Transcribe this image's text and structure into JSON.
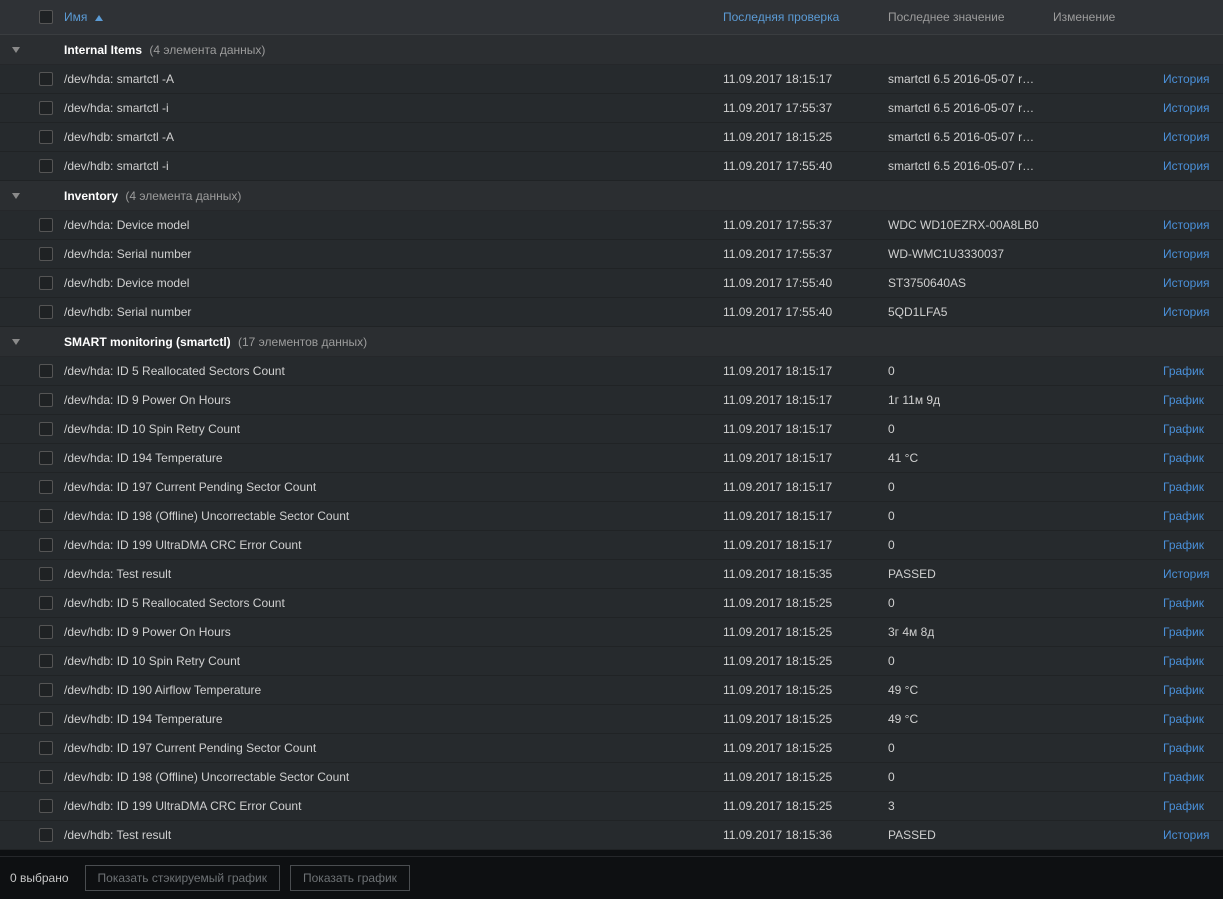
{
  "header": {
    "name": "Имя",
    "last_check": "Последняя проверка",
    "last_value": "Последнее значение",
    "change": "Изменение"
  },
  "action_labels": {
    "history": "История",
    "graph": "График"
  },
  "groups": [
    {
      "name": "Internal Items",
      "count_label": "(4 элемента данных)",
      "items": [
        {
          "name": "/dev/hda: smartctl -A",
          "time": "11.09.2017 18:15:17",
          "value": "smartctl 6.5 2016-05-07 r…",
          "action": "history"
        },
        {
          "name": "/dev/hda: smartctl -i",
          "time": "11.09.2017 17:55:37",
          "value": "smartctl 6.5 2016-05-07 r…",
          "action": "history"
        },
        {
          "name": "/dev/hdb: smartctl -A",
          "time": "11.09.2017 18:15:25",
          "value": "smartctl 6.5 2016-05-07 r…",
          "action": "history"
        },
        {
          "name": "/dev/hdb: smartctl -i",
          "time": "11.09.2017 17:55:40",
          "value": "smartctl 6.5 2016-05-07 r…",
          "action": "history"
        }
      ]
    },
    {
      "name": "Inventory",
      "count_label": "(4 элемента данных)",
      "items": [
        {
          "name": "/dev/hda: Device model",
          "time": "11.09.2017 17:55:37",
          "value": "WDC WD10EZRX-00A8LB0",
          "action": "history"
        },
        {
          "name": "/dev/hda: Serial number",
          "time": "11.09.2017 17:55:37",
          "value": "WD-WMC1U3330037",
          "action": "history"
        },
        {
          "name": "/dev/hdb: Device model",
          "time": "11.09.2017 17:55:40",
          "value": "ST3750640AS",
          "action": "history"
        },
        {
          "name": "/dev/hdb: Serial number",
          "time": "11.09.2017 17:55:40",
          "value": "5QD1LFA5",
          "action": "history"
        }
      ]
    },
    {
      "name": "SMART monitoring (smartctl)",
      "count_label": "(17 элементов данных)",
      "items": [
        {
          "name": "/dev/hda: ID 5 Reallocated Sectors Count",
          "time": "11.09.2017 18:15:17",
          "value": "0",
          "action": "graph"
        },
        {
          "name": "/dev/hda: ID 9 Power On Hours",
          "time": "11.09.2017 18:15:17",
          "value": "1г 11м 9д",
          "action": "graph"
        },
        {
          "name": "/dev/hda: ID 10 Spin Retry Count",
          "time": "11.09.2017 18:15:17",
          "value": "0",
          "action": "graph"
        },
        {
          "name": "/dev/hda: ID 194 Temperature",
          "time": "11.09.2017 18:15:17",
          "value": "41 °C",
          "action": "graph"
        },
        {
          "name": "/dev/hda: ID 197 Current Pending Sector Count",
          "time": "11.09.2017 18:15:17",
          "value": "0",
          "action": "graph"
        },
        {
          "name": "/dev/hda: ID 198 (Offline) Uncorrectable Sector Count",
          "time": "11.09.2017 18:15:17",
          "value": "0",
          "action": "graph"
        },
        {
          "name": "/dev/hda: ID 199 UltraDMA CRC Error Count",
          "time": "11.09.2017 18:15:17",
          "value": "0",
          "action": "graph"
        },
        {
          "name": "/dev/hda: Test result",
          "time": "11.09.2017 18:15:35",
          "value": "PASSED",
          "action": "history"
        },
        {
          "name": "/dev/hdb: ID 5 Reallocated Sectors Count",
          "time": "11.09.2017 18:15:25",
          "value": "0",
          "action": "graph"
        },
        {
          "name": "/dev/hdb: ID 9 Power On Hours",
          "time": "11.09.2017 18:15:25",
          "value": "3г 4м 8д",
          "action": "graph"
        },
        {
          "name": "/dev/hdb: ID 10 Spin Retry Count",
          "time": "11.09.2017 18:15:25",
          "value": "0",
          "action": "graph"
        },
        {
          "name": "/dev/hdb: ID 190 Airflow Temperature",
          "time": "11.09.2017 18:15:25",
          "value": "49 °C",
          "action": "graph"
        },
        {
          "name": "/dev/hdb: ID 194 Temperature",
          "time": "11.09.2017 18:15:25",
          "value": "49 °C",
          "action": "graph"
        },
        {
          "name": "/dev/hdb: ID 197 Current Pending Sector Count",
          "time": "11.09.2017 18:15:25",
          "value": "0",
          "action": "graph"
        },
        {
          "name": "/dev/hdb: ID 198 (Offline) Uncorrectable Sector Count",
          "time": "11.09.2017 18:15:25",
          "value": "0",
          "action": "graph"
        },
        {
          "name": "/dev/hdb: ID 199 UltraDMA CRC Error Count",
          "time": "11.09.2017 18:15:25",
          "value": "3",
          "action": "graph"
        },
        {
          "name": "/dev/hdb: Test result",
          "time": "11.09.2017 18:15:36",
          "value": "PASSED",
          "action": "history"
        }
      ]
    }
  ],
  "footer": {
    "selected": "0 выбрано",
    "stacked_graph_btn": "Показать стэкируемый график",
    "graph_btn": "Показать график"
  }
}
